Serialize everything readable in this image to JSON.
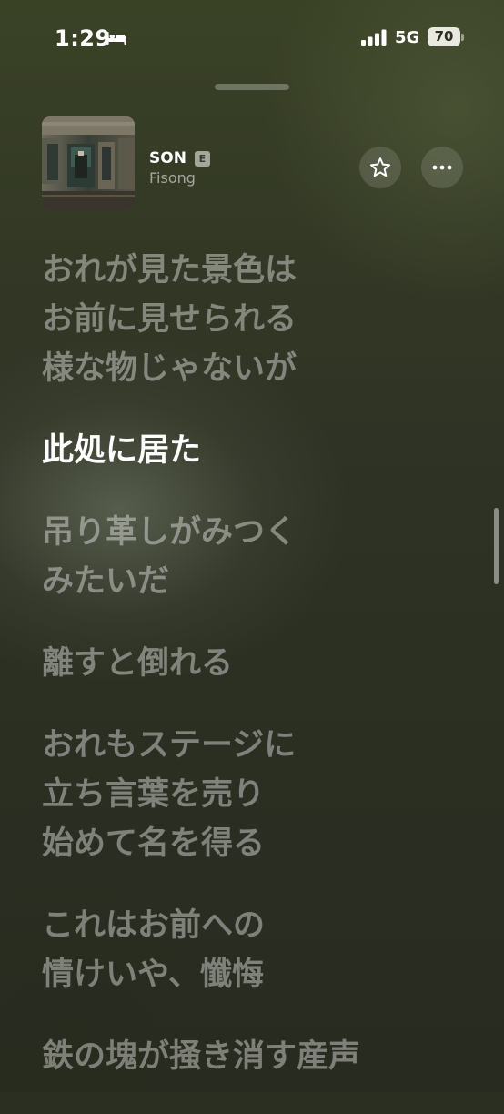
{
  "status_bar": {
    "time": "1:29",
    "focus_icon": "bed-icon",
    "signal_icon": "cellular-signal-icon",
    "network": "5G",
    "battery_percent": "70"
  },
  "now_playing": {
    "title": "SON",
    "explicit_badge": "E",
    "artist": "Fisong",
    "favorite_icon": "star-icon",
    "more_icon": "ellipsis-icon"
  },
  "lyrics": {
    "lines": [
      {
        "text": "おれが見た景色は\nお前に見せられる\n様な物じゃないが",
        "active": false
      },
      {
        "text": "此処に居た",
        "active": true
      },
      {
        "text": "吊り革しがみつく\nみたいだ",
        "active": false
      },
      {
        "text": "離すと倒れる",
        "active": false
      },
      {
        "text": "おれもステージに\n立ち言葉を売り\n始めて名を得る",
        "active": false
      },
      {
        "text": "これはお前への\n情けいや、懺悔",
        "active": false
      },
      {
        "text": "鉄の塊が掻き消す産声",
        "active": false
      }
    ]
  },
  "colors": {
    "background": "#2b2f22",
    "active_lyric": "#ffffff",
    "inactive_lyric": "rgba(255,255,255,0.40)"
  }
}
